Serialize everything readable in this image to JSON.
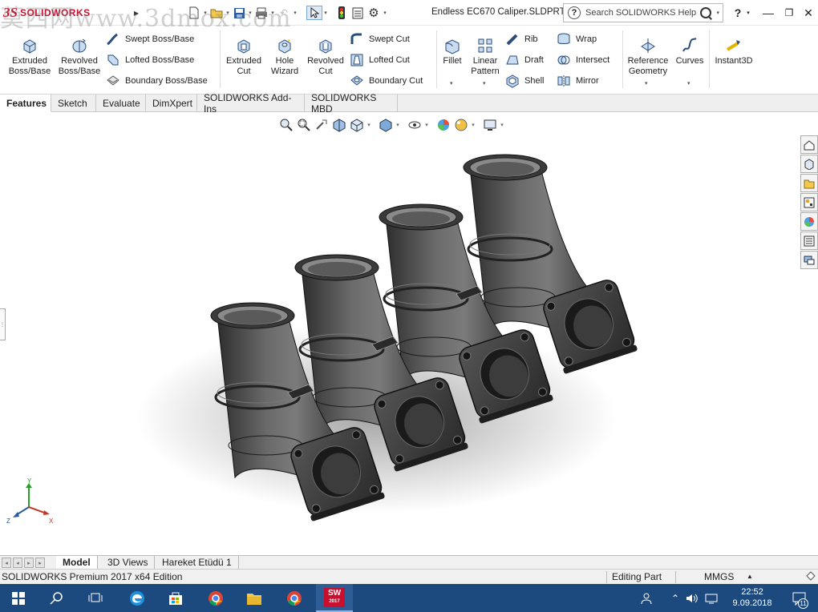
{
  "app": {
    "name": "SOLIDWORKS"
  },
  "titlebar": {
    "document_title": "Endless EC670 Caliper.SLDPRT",
    "search_placeholder": "Search SOLIDWORKS Help",
    "help_glyph": "?"
  },
  "ribbon": {
    "large_buttons": [
      {
        "id": "extruded-boss",
        "label": "Extruded\nBoss/Base",
        "icon": "extruded-boss-icon"
      },
      {
        "id": "revolved-boss",
        "label": "Revolved\nBoss/Base",
        "icon": "revolved-boss-icon"
      },
      {
        "id": "extruded-cut",
        "label": "Extruded\nCut",
        "icon": "extruded-cut-icon"
      },
      {
        "id": "hole-wizard",
        "label": "Hole\nWizard",
        "icon": "hole-wizard-icon"
      },
      {
        "id": "revolved-cut",
        "label": "Revolved\nCut",
        "icon": "revolved-cut-icon"
      },
      {
        "id": "fillet",
        "label": "Fillet",
        "icon": "fillet-icon"
      },
      {
        "id": "linear-pattern",
        "label": "Linear\nPattern",
        "icon": "linear-pattern-icon"
      },
      {
        "id": "reference-geometry",
        "label": "Reference\nGeometry",
        "icon": "reference-geometry-icon"
      },
      {
        "id": "curves",
        "label": "Curves",
        "icon": "curves-icon"
      },
      {
        "id": "instant3d",
        "label": "Instant3D",
        "icon": "instant3d-icon"
      }
    ],
    "small_buttons": [
      {
        "id": "swept-boss",
        "label": "Swept Boss/Base",
        "icon": "swept-boss-icon"
      },
      {
        "id": "lofted-boss",
        "label": "Lofted Boss/Base",
        "icon": "lofted-boss-icon"
      },
      {
        "id": "boundary-boss",
        "label": "Boundary Boss/Base",
        "icon": "boundary-boss-icon"
      },
      {
        "id": "swept-cut",
        "label": "Swept Cut",
        "icon": "swept-cut-icon"
      },
      {
        "id": "lofted-cut",
        "label": "Lofted Cut",
        "icon": "lofted-cut-icon"
      },
      {
        "id": "boundary-cut",
        "label": "Boundary Cut",
        "icon": "boundary-cut-icon"
      },
      {
        "id": "rib",
        "label": "Rib",
        "icon": "rib-icon"
      },
      {
        "id": "draft",
        "label": "Draft",
        "icon": "draft-icon"
      },
      {
        "id": "shell",
        "label": "Shell",
        "icon": "shell-icon"
      },
      {
        "id": "wrap",
        "label": "Wrap",
        "icon": "wrap-icon"
      },
      {
        "id": "intersect",
        "label": "Intersect",
        "icon": "intersect-icon"
      },
      {
        "id": "mirror",
        "label": "Mirror",
        "icon": "mirror-icon"
      }
    ]
  },
  "command_tabs": [
    "Features",
    "Sketch",
    "Evaluate",
    "DimXpert",
    "SOLIDWORKS Add-Ins",
    "SOLIDWORKS MBD"
  ],
  "active_command_tab": "Features",
  "model_tabs": [
    "Model",
    "3D Views",
    "Hareket Etüdü 1"
  ],
  "active_model_tab": "Model",
  "status": {
    "edition": "SOLIDWORKS Premium 2017 x64 Edition",
    "mode": "Editing Part",
    "units": "MMGS"
  },
  "triad": {
    "x": "X",
    "y": "Y",
    "z": "Z"
  },
  "taskbar": {
    "time": "22:52",
    "date": "9.09.2018",
    "notifications": "11",
    "sw_badge": "2017"
  },
  "watermark": "莫西网www.3dmox.com",
  "colors": {
    "accent": "#c8102e",
    "model_body": "#4a4a4a",
    "taskbar": "#1c4a7e",
    "viewport_bg": "#ffffff"
  }
}
